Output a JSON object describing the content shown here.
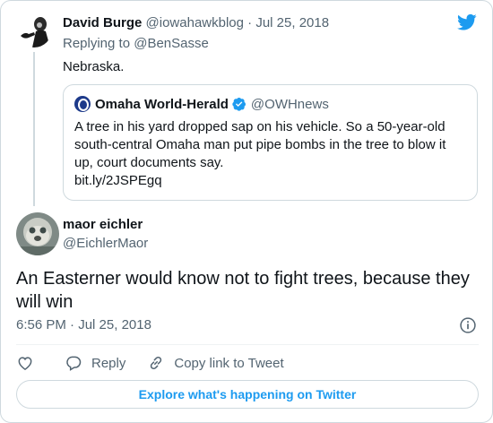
{
  "parent_tweet": {
    "name": "David Burge",
    "handle": "@iowahawkblog",
    "separator": "·",
    "date": "Jul 25, 2018",
    "replying_prefix": "Replying to",
    "replying_to": "@BenSasse",
    "text": "Nebraska."
  },
  "quoted_tweet": {
    "name": "Omaha World-Herald",
    "handle": "@OWHnews",
    "text_lines": [
      "A tree in his yard dropped sap on his vehicle. So a 50-year-old",
      "south-central Omaha man put pipe bombs in the tree to blow it",
      "up, court documents say.",
      "bit.ly/2JSPEgq"
    ]
  },
  "main_tweet": {
    "name": "maor eichler",
    "handle": "@EichlerMaor",
    "text_lines": [
      "An Easterner would know not to fight trees, because they",
      "will win"
    ],
    "time": "6:56 PM",
    "separator": "·",
    "date": "Jul 25, 2018"
  },
  "actions": {
    "reply_label": "Reply",
    "copy_link_label": "Copy link to Tweet"
  },
  "explore_label": "Explore what's happening on Twitter",
  "icons": {
    "brand": "twitter-bird-icon",
    "verified": "verified-badge-icon",
    "info": "info-icon",
    "like": "heart-icon",
    "reply": "speech-bubble-icon",
    "copy_link": "link-icon"
  },
  "colors": {
    "accent": "#1d9bf0",
    "text": "#0f1419",
    "secondary": "#536471",
    "border": "#cfd9de"
  }
}
